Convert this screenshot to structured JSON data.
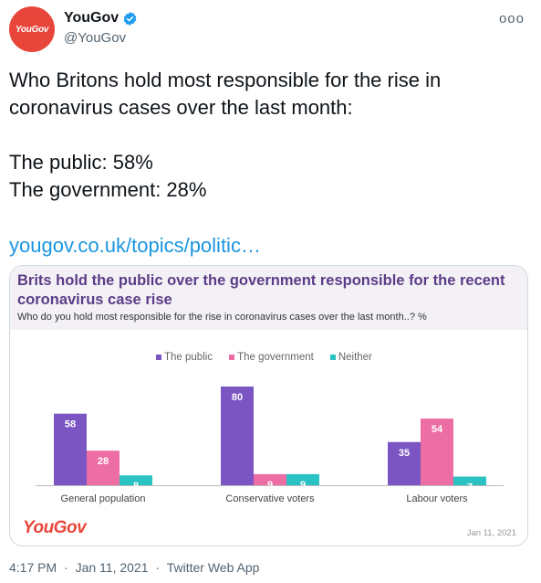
{
  "account": {
    "avatar_text": "YouGov",
    "display_name": "YouGov",
    "handle": "@YouGov",
    "more_label": "ooo"
  },
  "tweet": {
    "line1": "Who Britons hold most responsible for the rise in",
    "line2": "coronavirus cases over the last month:",
    "line3": "The public: 58%",
    "line4": "The government: 28%",
    "link": "yougov.co.uk/topics/politic…"
  },
  "card": {
    "title": "Brits hold the public over the government responsible for the recent coronavirus case rise",
    "subtitle": "Who do you hold most responsible for the rise in coronavirus cases over the last month..? %",
    "logo": "YouGov",
    "date": "Jan 11, 2021"
  },
  "meta": {
    "time": "4:17 PM",
    "date": "Jan 11, 2021",
    "source": "Twitter Web App"
  },
  "colors": {
    "public": "#7b56c2",
    "government": "#ec6ea4",
    "neither": "#2ac2c2",
    "accent": "#e8463a",
    "link": "#1b95e0"
  },
  "chart_data": {
    "type": "bar",
    "title": "Brits hold the public over the government responsible for the recent coronavirus case rise",
    "subtitle": "Who do you hold most responsible for the rise in coronavirus cases over the last month..? %",
    "categories": [
      "General population",
      "Conservative voters",
      "Labour voters"
    ],
    "series": [
      {
        "name": "The public",
        "values": [
          58,
          80,
          35
        ]
      },
      {
        "name": "The government",
        "values": [
          28,
          9,
          54
        ]
      },
      {
        "name": "Neither",
        "values": [
          8,
          9,
          7
        ]
      }
    ],
    "ylim": [
      0,
      80
    ],
    "legend": "top-center",
    "grid": false
  }
}
